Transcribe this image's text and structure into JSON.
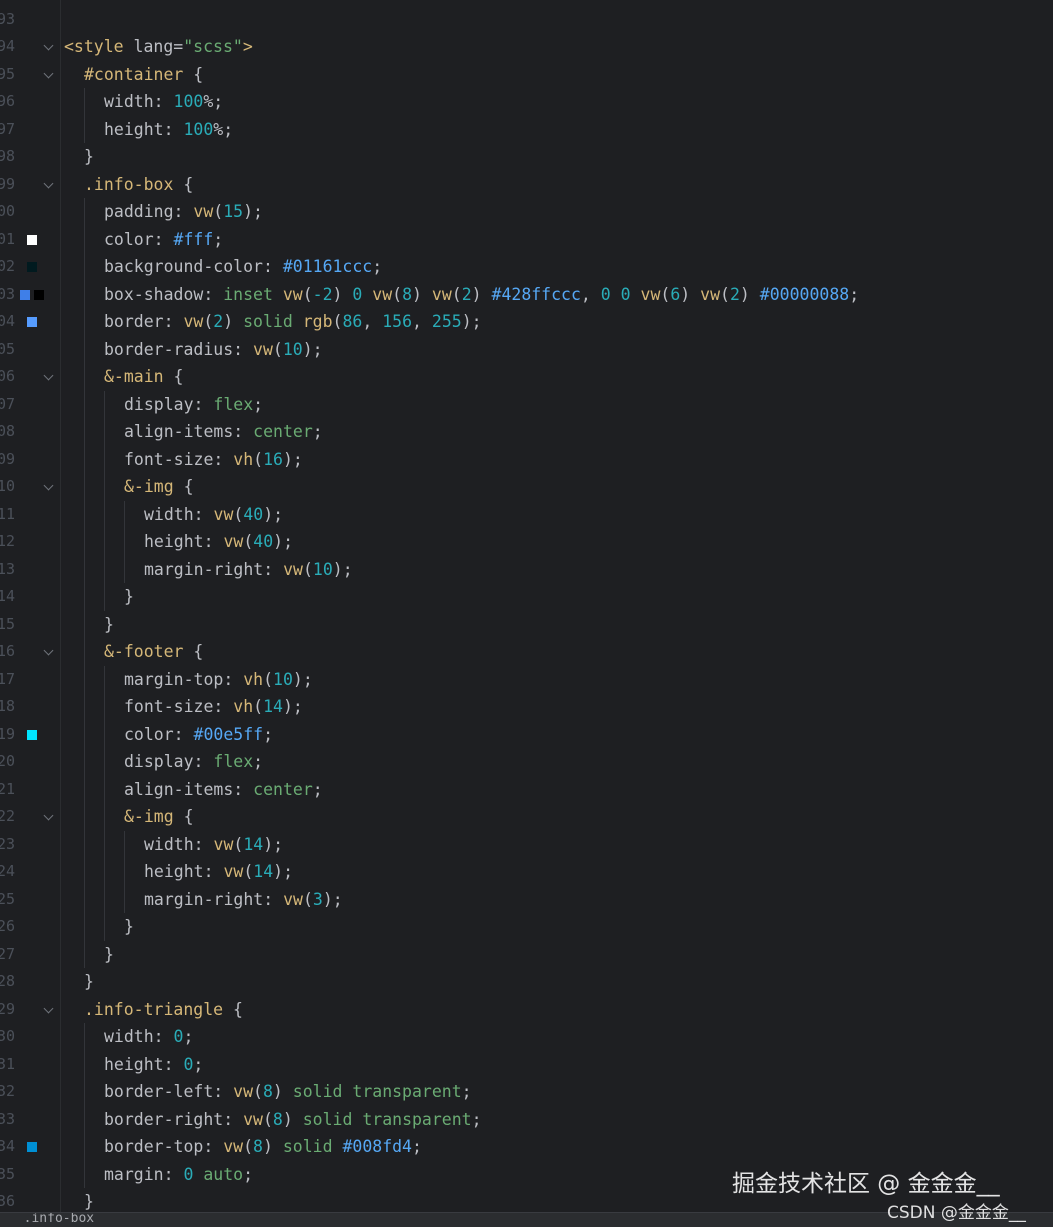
{
  "colors": {
    "background": "#1e1f22",
    "line_number": "#4b5059",
    "tag": "#d5b778",
    "string": "#6aab73",
    "number": "#2aacb8",
    "hex": "#56a8f5",
    "text": "#bcbec4"
  },
  "lines": [
    {
      "n": "93",
      "fold": false,
      "indent": 0,
      "tokens": [
        {
          "t": "",
          "c": "plain"
        }
      ]
    },
    {
      "n": "94",
      "fold": true,
      "indent": 0,
      "tokens": [
        {
          "t": "<style",
          "c": "tag"
        },
        {
          "t": " lang=",
          "c": "attr"
        },
        {
          "t": "\"scss\"",
          "c": "str"
        },
        {
          "t": ">",
          "c": "tag"
        }
      ]
    },
    {
      "n": "95",
      "fold": true,
      "indent": 1,
      "tokens": [
        {
          "t": "#container",
          "c": "sel"
        },
        {
          "t": " {",
          "c": "plain"
        }
      ]
    },
    {
      "n": "96",
      "fold": false,
      "indent": 2,
      "tokens": [
        {
          "t": "width",
          "c": "prop"
        },
        {
          "t": ": ",
          "c": "plain"
        },
        {
          "t": "100",
          "c": "num"
        },
        {
          "t": "%;",
          "c": "plain"
        }
      ]
    },
    {
      "n": "97",
      "fold": false,
      "indent": 2,
      "tokens": [
        {
          "t": "height",
          "c": "prop"
        },
        {
          "t": ": ",
          "c": "plain"
        },
        {
          "t": "100",
          "c": "num"
        },
        {
          "t": "%;",
          "c": "plain"
        }
      ]
    },
    {
      "n": "98",
      "fold": false,
      "indent": 1,
      "tokens": [
        {
          "t": "}",
          "c": "plain"
        }
      ]
    },
    {
      "n": "99",
      "fold": true,
      "indent": 1,
      "tokens": [
        {
          "t": ".info-box",
          "c": "sel"
        },
        {
          "t": " {",
          "c": "plain"
        }
      ]
    },
    {
      "n": "00",
      "fold": false,
      "indent": 2,
      "tokens": [
        {
          "t": "padding",
          "c": "prop"
        },
        {
          "t": ": ",
          "c": "plain"
        },
        {
          "t": "vw",
          "c": "fn"
        },
        {
          "t": "(",
          "c": "plain"
        },
        {
          "t": "15",
          "c": "num"
        },
        {
          "t": ");",
          "c": "plain"
        }
      ]
    },
    {
      "n": "01",
      "fold": false,
      "indent": 2,
      "swatches": [
        "#ffffff"
      ],
      "tokens": [
        {
          "t": "color",
          "c": "prop"
        },
        {
          "t": ": ",
          "c": "plain"
        },
        {
          "t": "#fff",
          "c": "hex"
        },
        {
          "t": ";",
          "c": "plain"
        }
      ]
    },
    {
      "n": "02",
      "fold": false,
      "indent": 2,
      "swatches": [
        "#011a1f"
      ],
      "tokens": [
        {
          "t": "background-color",
          "c": "prop"
        },
        {
          "t": ": ",
          "c": "plain"
        },
        {
          "t": "#01161ccc",
          "c": "hex"
        },
        {
          "t": ";",
          "c": "plain"
        }
      ]
    },
    {
      "n": "03",
      "fold": false,
      "indent": 2,
      "swatches": [
        "#3f7fe8",
        "#000000"
      ],
      "tokens": [
        {
          "t": "box-shadow",
          "c": "prop"
        },
        {
          "t": ": ",
          "c": "plain"
        },
        {
          "t": "inset",
          "c": "kw"
        },
        {
          "t": " ",
          "c": "plain"
        },
        {
          "t": "vw",
          "c": "fn"
        },
        {
          "t": "(",
          "c": "plain"
        },
        {
          "t": "-2",
          "c": "num"
        },
        {
          "t": ") ",
          "c": "plain"
        },
        {
          "t": "0",
          "c": "num"
        },
        {
          "t": " ",
          "c": "plain"
        },
        {
          "t": "vw",
          "c": "fn"
        },
        {
          "t": "(",
          "c": "plain"
        },
        {
          "t": "8",
          "c": "num"
        },
        {
          "t": ") ",
          "c": "plain"
        },
        {
          "t": "vw",
          "c": "fn"
        },
        {
          "t": "(",
          "c": "plain"
        },
        {
          "t": "2",
          "c": "num"
        },
        {
          "t": ") ",
          "c": "plain"
        },
        {
          "t": "#428ffccc",
          "c": "hex"
        },
        {
          "t": ", ",
          "c": "plain"
        },
        {
          "t": "0",
          "c": "num"
        },
        {
          "t": " ",
          "c": "plain"
        },
        {
          "t": "0",
          "c": "num"
        },
        {
          "t": " ",
          "c": "plain"
        },
        {
          "t": "vw",
          "c": "fn"
        },
        {
          "t": "(",
          "c": "plain"
        },
        {
          "t": "6",
          "c": "num"
        },
        {
          "t": ") ",
          "c": "plain"
        },
        {
          "t": "vw",
          "c": "fn"
        },
        {
          "t": "(",
          "c": "plain"
        },
        {
          "t": "2",
          "c": "num"
        },
        {
          "t": ") ",
          "c": "plain"
        },
        {
          "t": "#00000088",
          "c": "hex"
        },
        {
          "t": ";",
          "c": "plain"
        }
      ]
    },
    {
      "n": "04",
      "fold": false,
      "indent": 2,
      "swatches": [
        "#569cff"
      ],
      "tokens": [
        {
          "t": "border",
          "c": "prop"
        },
        {
          "t": ": ",
          "c": "plain"
        },
        {
          "t": "vw",
          "c": "fn"
        },
        {
          "t": "(",
          "c": "plain"
        },
        {
          "t": "2",
          "c": "num"
        },
        {
          "t": ") ",
          "c": "plain"
        },
        {
          "t": "solid",
          "c": "kw"
        },
        {
          "t": " ",
          "c": "plain"
        },
        {
          "t": "rgb",
          "c": "fn"
        },
        {
          "t": "(",
          "c": "plain"
        },
        {
          "t": "86",
          "c": "num"
        },
        {
          "t": ", ",
          "c": "plain"
        },
        {
          "t": "156",
          "c": "num"
        },
        {
          "t": ", ",
          "c": "plain"
        },
        {
          "t": "255",
          "c": "num"
        },
        {
          "t": ");",
          "c": "plain"
        }
      ]
    },
    {
      "n": "05",
      "fold": false,
      "indent": 2,
      "tokens": [
        {
          "t": "border-radius",
          "c": "prop"
        },
        {
          "t": ": ",
          "c": "plain"
        },
        {
          "t": "vw",
          "c": "fn"
        },
        {
          "t": "(",
          "c": "plain"
        },
        {
          "t": "10",
          "c": "num"
        },
        {
          "t": ");",
          "c": "plain"
        }
      ]
    },
    {
      "n": "06",
      "fold": true,
      "indent": 2,
      "tokens": [
        {
          "t": "&-main",
          "c": "sel"
        },
        {
          "t": " {",
          "c": "plain"
        }
      ]
    },
    {
      "n": "07",
      "fold": false,
      "indent": 3,
      "tokens": [
        {
          "t": "display",
          "c": "prop"
        },
        {
          "t": ": ",
          "c": "plain"
        },
        {
          "t": "flex",
          "c": "kw"
        },
        {
          "t": ";",
          "c": "plain"
        }
      ]
    },
    {
      "n": "08",
      "fold": false,
      "indent": 3,
      "tokens": [
        {
          "t": "align-items",
          "c": "prop"
        },
        {
          "t": ": ",
          "c": "plain"
        },
        {
          "t": "center",
          "c": "kw"
        },
        {
          "t": ";",
          "c": "plain"
        }
      ]
    },
    {
      "n": "09",
      "fold": false,
      "indent": 3,
      "tokens": [
        {
          "t": "font-size",
          "c": "prop"
        },
        {
          "t": ": ",
          "c": "plain"
        },
        {
          "t": "vh",
          "c": "fn"
        },
        {
          "t": "(",
          "c": "plain"
        },
        {
          "t": "16",
          "c": "num"
        },
        {
          "t": ");",
          "c": "plain"
        }
      ]
    },
    {
      "n": "10",
      "fold": true,
      "indent": 3,
      "tokens": [
        {
          "t": "&-img",
          "c": "sel"
        },
        {
          "t": " {",
          "c": "plain"
        }
      ]
    },
    {
      "n": "11",
      "fold": false,
      "indent": 4,
      "tokens": [
        {
          "t": "width",
          "c": "prop"
        },
        {
          "t": ": ",
          "c": "plain"
        },
        {
          "t": "vw",
          "c": "fn"
        },
        {
          "t": "(",
          "c": "plain"
        },
        {
          "t": "40",
          "c": "num"
        },
        {
          "t": ");",
          "c": "plain"
        }
      ]
    },
    {
      "n": "12",
      "fold": false,
      "indent": 4,
      "tokens": [
        {
          "t": "height",
          "c": "prop"
        },
        {
          "t": ": ",
          "c": "plain"
        },
        {
          "t": "vw",
          "c": "fn"
        },
        {
          "t": "(",
          "c": "plain"
        },
        {
          "t": "40",
          "c": "num"
        },
        {
          "t": ");",
          "c": "plain"
        }
      ]
    },
    {
      "n": "13",
      "fold": false,
      "indent": 4,
      "tokens": [
        {
          "t": "margin-right",
          "c": "prop"
        },
        {
          "t": ": ",
          "c": "plain"
        },
        {
          "t": "vw",
          "c": "fn"
        },
        {
          "t": "(",
          "c": "plain"
        },
        {
          "t": "10",
          "c": "num"
        },
        {
          "t": ");",
          "c": "plain"
        }
      ]
    },
    {
      "n": "14",
      "fold": false,
      "indent": 3,
      "tokens": [
        {
          "t": "}",
          "c": "plain"
        }
      ]
    },
    {
      "n": "15",
      "fold": false,
      "indent": 2,
      "tokens": [
        {
          "t": "}",
          "c": "plain"
        }
      ]
    },
    {
      "n": "16",
      "fold": true,
      "indent": 2,
      "tokens": [
        {
          "t": "&-footer",
          "c": "sel"
        },
        {
          "t": " {",
          "c": "plain"
        }
      ]
    },
    {
      "n": "17",
      "fold": false,
      "indent": 3,
      "tokens": [
        {
          "t": "margin-top",
          "c": "prop"
        },
        {
          "t": ": ",
          "c": "plain"
        },
        {
          "t": "vh",
          "c": "fn"
        },
        {
          "t": "(",
          "c": "plain"
        },
        {
          "t": "10",
          "c": "num"
        },
        {
          "t": ");",
          "c": "plain"
        }
      ]
    },
    {
      "n": "18",
      "fold": false,
      "indent": 3,
      "tokens": [
        {
          "t": "font-size",
          "c": "prop"
        },
        {
          "t": ": ",
          "c": "plain"
        },
        {
          "t": "vh",
          "c": "fn"
        },
        {
          "t": "(",
          "c": "plain"
        },
        {
          "t": "14",
          "c": "num"
        },
        {
          "t": ");",
          "c": "plain"
        }
      ]
    },
    {
      "n": "19",
      "fold": false,
      "indent": 3,
      "swatches": [
        "#00e5ff"
      ],
      "tokens": [
        {
          "t": "color",
          "c": "prop"
        },
        {
          "t": ": ",
          "c": "plain"
        },
        {
          "t": "#00e5ff",
          "c": "hex"
        },
        {
          "t": ";",
          "c": "plain"
        }
      ]
    },
    {
      "n": "20",
      "fold": false,
      "indent": 3,
      "tokens": [
        {
          "t": "display",
          "c": "prop"
        },
        {
          "t": ": ",
          "c": "plain"
        },
        {
          "t": "flex",
          "c": "kw"
        },
        {
          "t": ";",
          "c": "plain"
        }
      ]
    },
    {
      "n": "21",
      "fold": false,
      "indent": 3,
      "tokens": [
        {
          "t": "align-items",
          "c": "prop"
        },
        {
          "t": ": ",
          "c": "plain"
        },
        {
          "t": "center",
          "c": "kw"
        },
        {
          "t": ";",
          "c": "plain"
        }
      ]
    },
    {
      "n": "22",
      "fold": true,
      "indent": 3,
      "tokens": [
        {
          "t": "&-img",
          "c": "sel"
        },
        {
          "t": " {",
          "c": "plain"
        }
      ]
    },
    {
      "n": "23",
      "fold": false,
      "indent": 4,
      "tokens": [
        {
          "t": "width",
          "c": "prop"
        },
        {
          "t": ": ",
          "c": "plain"
        },
        {
          "t": "vw",
          "c": "fn"
        },
        {
          "t": "(",
          "c": "plain"
        },
        {
          "t": "14",
          "c": "num"
        },
        {
          "t": ");",
          "c": "plain"
        }
      ]
    },
    {
      "n": "24",
      "fold": false,
      "indent": 4,
      "tokens": [
        {
          "t": "height",
          "c": "prop"
        },
        {
          "t": ": ",
          "c": "plain"
        },
        {
          "t": "vw",
          "c": "fn"
        },
        {
          "t": "(",
          "c": "plain"
        },
        {
          "t": "14",
          "c": "num"
        },
        {
          "t": ");",
          "c": "plain"
        }
      ]
    },
    {
      "n": "25",
      "fold": false,
      "indent": 4,
      "tokens": [
        {
          "t": "margin-right",
          "c": "prop"
        },
        {
          "t": ": ",
          "c": "plain"
        },
        {
          "t": "vw",
          "c": "fn"
        },
        {
          "t": "(",
          "c": "plain"
        },
        {
          "t": "3",
          "c": "num"
        },
        {
          "t": ");",
          "c": "plain"
        }
      ]
    },
    {
      "n": "26",
      "fold": false,
      "indent": 3,
      "tokens": [
        {
          "t": "}",
          "c": "plain"
        }
      ]
    },
    {
      "n": "27",
      "fold": false,
      "indent": 2,
      "tokens": [
        {
          "t": "}",
          "c": "plain"
        }
      ]
    },
    {
      "n": "28",
      "fold": false,
      "indent": 1,
      "tokens": [
        {
          "t": "}",
          "c": "plain"
        }
      ]
    },
    {
      "n": "29",
      "fold": true,
      "indent": 1,
      "tokens": [
        {
          "t": ".info-triangle",
          "c": "sel"
        },
        {
          "t": " {",
          "c": "plain"
        }
      ]
    },
    {
      "n": "30",
      "fold": false,
      "indent": 2,
      "tokens": [
        {
          "t": "width",
          "c": "prop"
        },
        {
          "t": ": ",
          "c": "plain"
        },
        {
          "t": "0",
          "c": "num"
        },
        {
          "t": ";",
          "c": "plain"
        }
      ]
    },
    {
      "n": "31",
      "fold": false,
      "indent": 2,
      "tokens": [
        {
          "t": "height",
          "c": "prop"
        },
        {
          "t": ": ",
          "c": "plain"
        },
        {
          "t": "0",
          "c": "num"
        },
        {
          "t": ";",
          "c": "plain"
        }
      ]
    },
    {
      "n": "32",
      "fold": false,
      "indent": 2,
      "tokens": [
        {
          "t": "border-left",
          "c": "prop"
        },
        {
          "t": ": ",
          "c": "plain"
        },
        {
          "t": "vw",
          "c": "fn"
        },
        {
          "t": "(",
          "c": "plain"
        },
        {
          "t": "8",
          "c": "num"
        },
        {
          "t": ") ",
          "c": "plain"
        },
        {
          "t": "solid",
          "c": "kw"
        },
        {
          "t": " ",
          "c": "plain"
        },
        {
          "t": "transparent",
          "c": "kw"
        },
        {
          "t": ";",
          "c": "plain"
        }
      ]
    },
    {
      "n": "33",
      "fold": false,
      "indent": 2,
      "tokens": [
        {
          "t": "border-right",
          "c": "prop"
        },
        {
          "t": ": ",
          "c": "plain"
        },
        {
          "t": "vw",
          "c": "fn"
        },
        {
          "t": "(",
          "c": "plain"
        },
        {
          "t": "8",
          "c": "num"
        },
        {
          "t": ") ",
          "c": "plain"
        },
        {
          "t": "solid",
          "c": "kw"
        },
        {
          "t": " ",
          "c": "plain"
        },
        {
          "t": "transparent",
          "c": "kw"
        },
        {
          "t": ";",
          "c": "plain"
        }
      ]
    },
    {
      "n": "34",
      "fold": false,
      "indent": 2,
      "swatches": [
        "#008fd4"
      ],
      "tokens": [
        {
          "t": "border-top",
          "c": "prop"
        },
        {
          "t": ": ",
          "c": "plain"
        },
        {
          "t": "vw",
          "c": "fn"
        },
        {
          "t": "(",
          "c": "plain"
        },
        {
          "t": "8",
          "c": "num"
        },
        {
          "t": ") ",
          "c": "plain"
        },
        {
          "t": "solid",
          "c": "kw"
        },
        {
          "t": " ",
          "c": "plain"
        },
        {
          "t": "#008fd4",
          "c": "hex"
        },
        {
          "t": ";",
          "c": "plain"
        }
      ]
    },
    {
      "n": "35",
      "fold": false,
      "indent": 2,
      "tokens": [
        {
          "t": "margin",
          "c": "prop"
        },
        {
          "t": ": ",
          "c": "plain"
        },
        {
          "t": "0",
          "c": "num"
        },
        {
          "t": " ",
          "c": "plain"
        },
        {
          "t": "auto",
          "c": "kw"
        },
        {
          "t": ";",
          "c": "plain"
        }
      ]
    },
    {
      "n": "36",
      "fold": false,
      "indent": 1,
      "tokens": [
        {
          "t": "}",
          "c": "plain"
        }
      ]
    }
  ],
  "status_bar": {
    "text": "  .info-box"
  },
  "watermark": {
    "main": "掘金技术社区 @ 金金金__",
    "sub": "CSDN @金金金__"
  }
}
